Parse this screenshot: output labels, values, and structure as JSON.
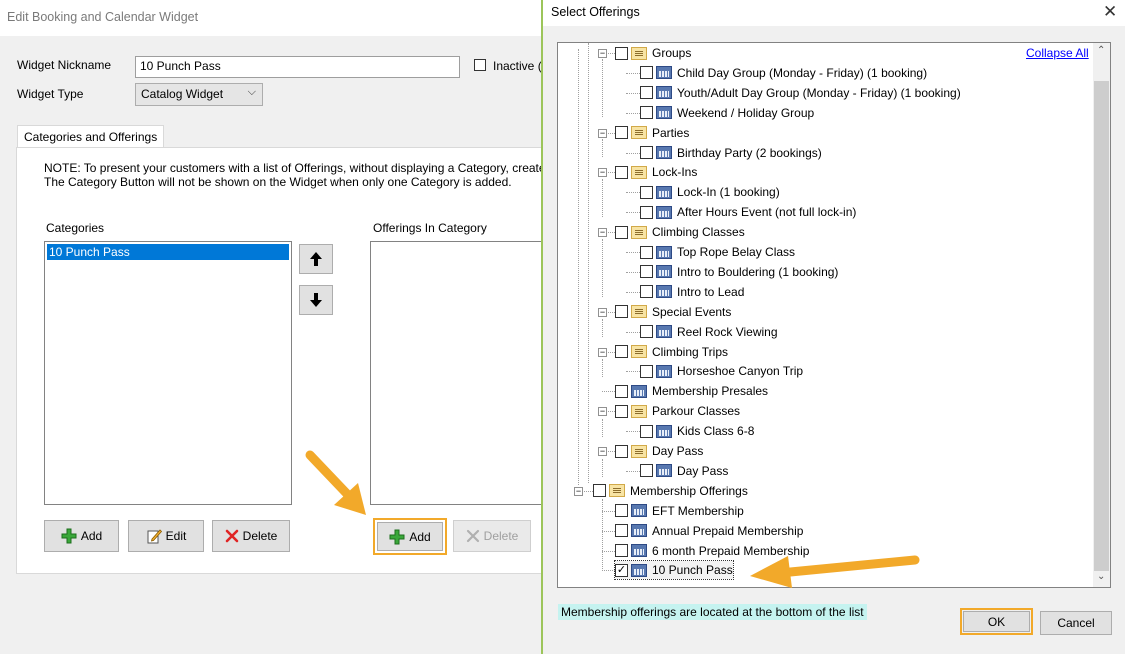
{
  "edit_window": {
    "title": "Edit Booking and Calendar Widget",
    "nickname_label": "Widget Nickname",
    "nickname_value": "10 Punch Pass",
    "inactive_label": "Inactive (",
    "type_label": "Widget Type",
    "type_value": "Catalog Widget",
    "tab_label": "Categories and Offerings",
    "note_line1": "NOTE: To present your customers with a list of Offerings, without displaying a Category, create ju",
    "note_line2": "The Category Button will not be shown on the Widget when only one Category is added.",
    "categories_label": "Categories",
    "categories": [
      "10 Punch Pass"
    ],
    "offerings_label": "Offerings In Category",
    "add_label": "Add",
    "edit_label": "Edit",
    "delete_label": "Delete",
    "offer_add_label": "Add",
    "offer_delete_label": "Delete"
  },
  "dialog": {
    "title": "Select Offerings",
    "collapse_all": "Collapse All",
    "tree": [
      {
        "label": "Groups",
        "type": "folder",
        "level": 1,
        "checked": false
      },
      {
        "label": "Child Day Group (Monday - Friday) (1 booking)",
        "type": "item",
        "level": 2,
        "checked": false
      },
      {
        "label": "Youth/Adult Day Group (Monday - Friday) (1 booking)",
        "type": "item",
        "level": 2,
        "checked": false
      },
      {
        "label": "Weekend / Holiday Group",
        "type": "item",
        "level": 2,
        "checked": false
      },
      {
        "label": "Parties",
        "type": "folder",
        "level": 1,
        "checked": false
      },
      {
        "label": "Birthday Party (2 bookings)",
        "type": "item",
        "level": 2,
        "checked": false
      },
      {
        "label": "Lock-Ins",
        "type": "folder",
        "level": 1,
        "checked": false
      },
      {
        "label": "Lock-In (1 booking)",
        "type": "item",
        "level": 2,
        "checked": false
      },
      {
        "label": "After Hours Event (not full lock-in)",
        "type": "item",
        "level": 2,
        "checked": false
      },
      {
        "label": "Climbing Classes",
        "type": "folder",
        "level": 1,
        "checked": false
      },
      {
        "label": "Top Rope Belay Class",
        "type": "item",
        "level": 2,
        "checked": false
      },
      {
        "label": "Intro to Bouldering (1 booking)",
        "type": "item",
        "level": 2,
        "checked": false
      },
      {
        "label": "Intro to Lead",
        "type": "item",
        "level": 2,
        "checked": false
      },
      {
        "label": "Special Events",
        "type": "folder",
        "level": 1,
        "checked": false
      },
      {
        "label": "Reel Rock Viewing",
        "type": "item",
        "level": 2,
        "checked": false
      },
      {
        "label": "Climbing Trips",
        "type": "folder",
        "level": 1,
        "checked": false
      },
      {
        "label": "Horseshoe Canyon Trip",
        "type": "item",
        "level": 2,
        "checked": false
      },
      {
        "label": "Membership Presales",
        "type": "item",
        "level": 1,
        "checked": false
      },
      {
        "label": "Parkour Classes",
        "type": "folder",
        "level": 1,
        "checked": false
      },
      {
        "label": "Kids Class 6-8",
        "type": "item",
        "level": 2,
        "checked": false
      },
      {
        "label": "Day Pass",
        "type": "folder",
        "level": 1,
        "checked": false
      },
      {
        "label": "Day Pass",
        "type": "item",
        "level": 2,
        "checked": false
      },
      {
        "label": "Membership Offerings",
        "type": "folder",
        "level": 0,
        "checked": false
      },
      {
        "label": "EFT Membership",
        "type": "item",
        "level": 1,
        "checked": false
      },
      {
        "label": "Annual Prepaid Membership",
        "type": "item",
        "level": 1,
        "checked": false
      },
      {
        "label": "6 month Prepaid Membership",
        "type": "item",
        "level": 1,
        "checked": false
      },
      {
        "label": "10 Punch Pass",
        "type": "item",
        "level": 1,
        "checked": true
      }
    ],
    "hint": "Membership offerings are located at the bottom of the list",
    "ok_label": "OK",
    "cancel_label": "Cancel"
  },
  "colors": {
    "highlight_orange": "#f2a92a",
    "selection_blue": "#0078d7",
    "hint_bg": "#c5f3f0",
    "link_blue": "#0000ff"
  }
}
